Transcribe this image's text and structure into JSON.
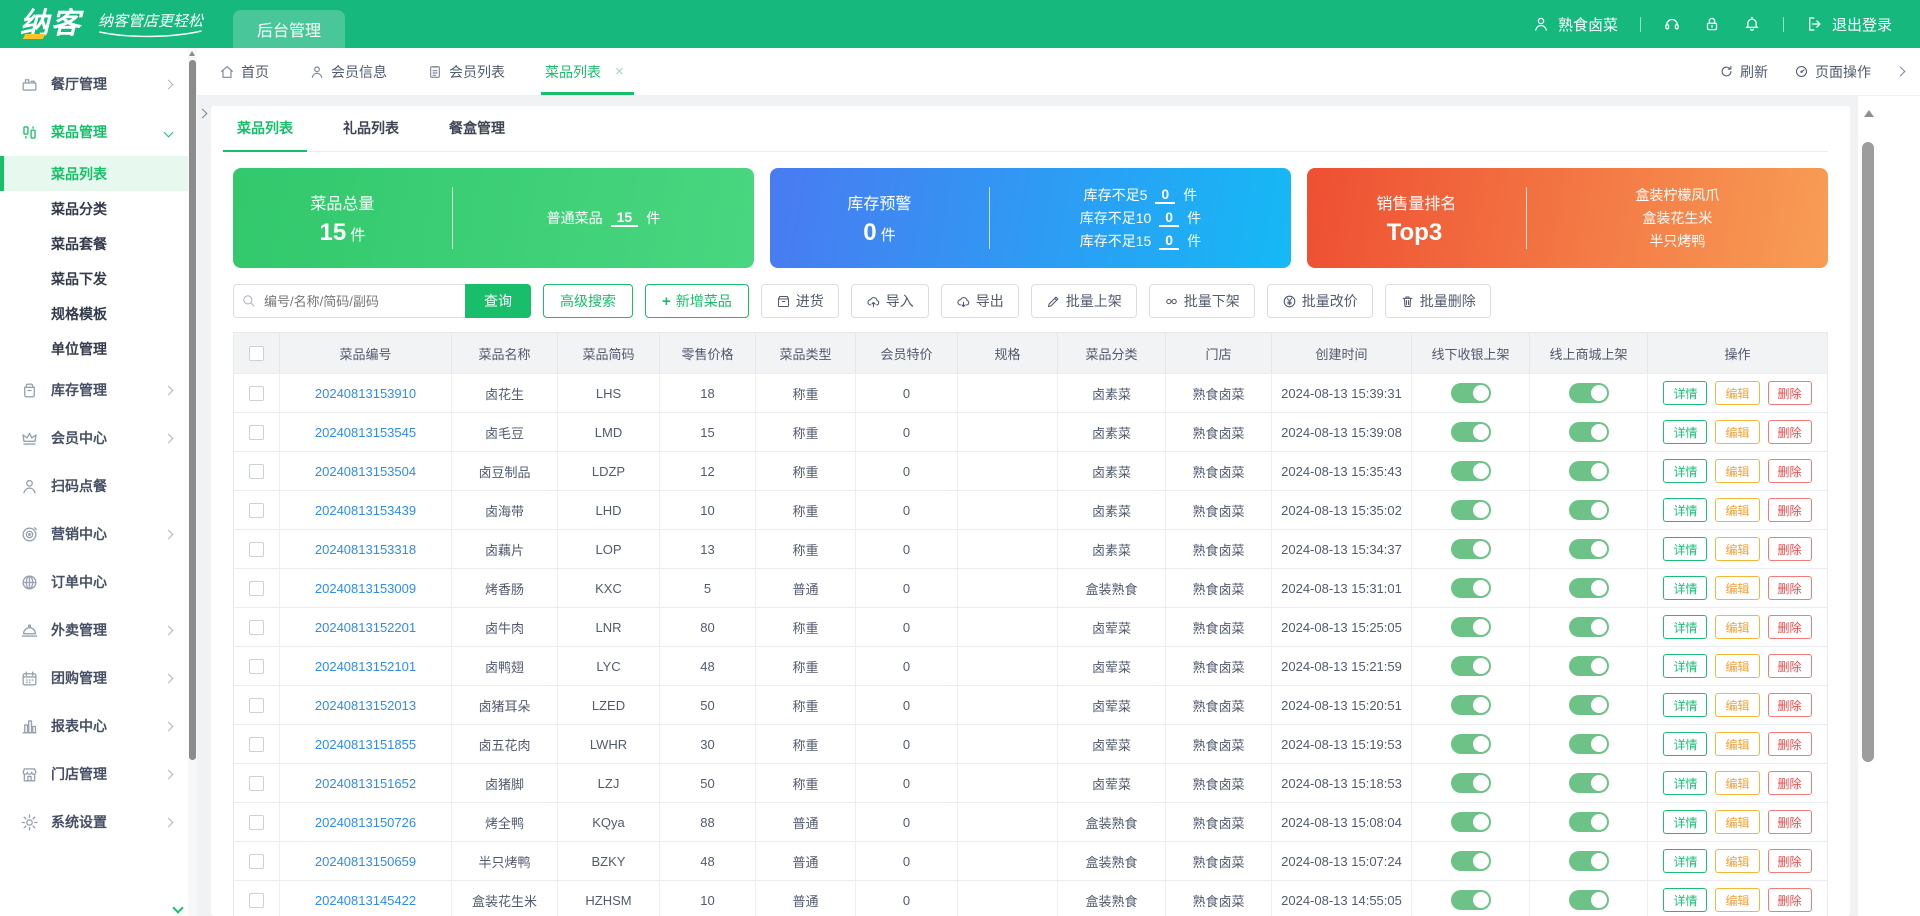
{
  "header": {
    "logo": "纳客",
    "tagline": "纳客管店更轻松",
    "admin_tab": "后台管理",
    "user": "熟食卤菜",
    "logout": "退出登录",
    "icons": [
      "user-icon",
      "headset-icon",
      "lock-icon",
      "bell-icon",
      "logout-icon"
    ]
  },
  "tabbar": {
    "tabs": [
      {
        "label": "首页",
        "icon": "home-icon"
      },
      {
        "label": "会员信息",
        "icon": "user-icon"
      },
      {
        "label": "会员列表",
        "icon": "document-icon"
      },
      {
        "label": "菜品列表",
        "active": true,
        "close": "×"
      }
    ],
    "refresh": "刷新",
    "page_ops": "页面操作"
  },
  "sidebar": {
    "items": [
      {
        "label": "餐厅管理",
        "icon": "store-icon",
        "arrow": "right"
      },
      {
        "label": "菜品管理",
        "icon": "dishes-icon",
        "arrow": "down",
        "open": true
      },
      {
        "label": "库存管理",
        "icon": "stock-icon",
        "arrow": "right"
      },
      {
        "label": "会员中心",
        "icon": "crown-icon",
        "arrow": "right"
      },
      {
        "label": "扫码点餐",
        "icon": "person-icon",
        "arrow": ""
      },
      {
        "label": "营销中心",
        "icon": "target-icon",
        "arrow": "right"
      },
      {
        "label": "订单中心",
        "icon": "globe-icon",
        "arrow": ""
      },
      {
        "label": "外卖管理",
        "icon": "cloche-icon",
        "arrow": "right"
      },
      {
        "label": "团购管理",
        "icon": "calendar-icon",
        "arrow": "right"
      },
      {
        "label": "报表中心",
        "icon": "chart-icon",
        "arrow": "right"
      },
      {
        "label": "门店管理",
        "icon": "shopfront-icon",
        "arrow": "right"
      },
      {
        "label": "系统设置",
        "icon": "gear-icon",
        "arrow": "right"
      }
    ],
    "dish_children": [
      {
        "label": "菜品列表",
        "active": true
      },
      {
        "label": "菜品分类"
      },
      {
        "label": "菜品套餐"
      },
      {
        "label": "菜品下发"
      },
      {
        "label": "规格模板"
      },
      {
        "label": "单位管理"
      }
    ]
  },
  "page": {
    "subtabs": [
      "菜品列表",
      "礼品列表",
      "餐盒管理"
    ],
    "cards": {
      "green": {
        "title": "菜品总量",
        "value": "15",
        "unit": "件",
        "rows": [
          {
            "label": "普通菜品",
            "value": "15",
            "unit": "件"
          }
        ]
      },
      "blue": {
        "title": "库存预警",
        "value": "0",
        "unit": "件",
        "rows": [
          {
            "label": "库存不足5",
            "value": "0",
            "unit": "件"
          },
          {
            "label": "库存不足10",
            "value": "0",
            "unit": "件"
          },
          {
            "label": "库存不足15",
            "value": "0",
            "unit": "件"
          }
        ]
      },
      "orange": {
        "title": "销售量排名",
        "value": "Top3",
        "items": [
          "盒装柠檬凤爪",
          "盒装花生米",
          "半只烤鸭"
        ]
      }
    },
    "toolbar": {
      "search_placeholder": "编号/名称/简码/副码",
      "query": "查询",
      "advanced": "高级搜索",
      "add_plus": "+",
      "add": "新增菜品",
      "gray_buttons": [
        {
          "label": "进货",
          "icon": "#i-box"
        },
        {
          "label": "导入",
          "icon": "#i-upload"
        },
        {
          "label": "导出",
          "icon": "#i-download"
        },
        {
          "label": "批量上架",
          "icon": "#i-pencil"
        },
        {
          "label": "批量下架",
          "icon": "#i-infinity"
        },
        {
          "label": "批量改价",
          "icon": "#i-yen"
        },
        {
          "label": "批量删除",
          "icon": "#i-trash"
        }
      ]
    },
    "table": {
      "columns": [
        "菜品编号",
        "菜品名称",
        "菜品简码",
        "零售价格",
        "菜品类型",
        "会员特价",
        "规格",
        "菜品分类",
        "门店",
        "创建时间",
        "线下收银上架",
        "线上商城上架",
        "操作"
      ],
      "actions": {
        "detail": "详情",
        "edit": "编辑",
        "del": "删除"
      },
      "rows": [
        {
          "code": "20240813153910",
          "name": "卤花生",
          "short": "LHS",
          "price": "18",
          "type": "称重",
          "vip": "0",
          "spec": "",
          "category": "卤素菜",
          "store": "熟食卤菜",
          "created": "2024-08-13 15:39:31"
        },
        {
          "code": "20240813153545",
          "name": "卤毛豆",
          "short": "LMD",
          "price": "15",
          "type": "称重",
          "vip": "0",
          "spec": "",
          "category": "卤素菜",
          "store": "熟食卤菜",
          "created": "2024-08-13 15:39:08"
        },
        {
          "code": "20240813153504",
          "name": "卤豆制品",
          "short": "LDZP",
          "price": "12",
          "type": "称重",
          "vip": "0",
          "spec": "",
          "category": "卤素菜",
          "store": "熟食卤菜",
          "created": "2024-08-13 15:35:43"
        },
        {
          "code": "20240813153439",
          "name": "卤海带",
          "short": "LHD",
          "price": "10",
          "type": "称重",
          "vip": "0",
          "spec": "",
          "category": "卤素菜",
          "store": "熟食卤菜",
          "created": "2024-08-13 15:35:02"
        },
        {
          "code": "20240813153318",
          "name": "卤藕片",
          "short": "LOP",
          "price": "13",
          "type": "称重",
          "vip": "0",
          "spec": "",
          "category": "卤素菜",
          "store": "熟食卤菜",
          "created": "2024-08-13 15:34:37"
        },
        {
          "code": "20240813153009",
          "name": "烤香肠",
          "short": "KXC",
          "price": "5",
          "type": "普通",
          "vip": "0",
          "spec": "",
          "category": "盒装熟食",
          "store": "熟食卤菜",
          "created": "2024-08-13 15:31:01"
        },
        {
          "code": "20240813152201",
          "name": "卤牛肉",
          "short": "LNR",
          "price": "80",
          "type": "称重",
          "vip": "0",
          "spec": "",
          "category": "卤荤菜",
          "store": "熟食卤菜",
          "created": "2024-08-13 15:25:05"
        },
        {
          "code": "20240813152101",
          "name": "卤鸭翅",
          "short": "LYC",
          "price": "48",
          "type": "称重",
          "vip": "0",
          "spec": "",
          "category": "卤荤菜",
          "store": "熟食卤菜",
          "created": "2024-08-13 15:21:59"
        },
        {
          "code": "20240813152013",
          "name": "卤猪耳朵",
          "short": "LZED",
          "price": "50",
          "type": "称重",
          "vip": "0",
          "spec": "",
          "category": "卤荤菜",
          "store": "熟食卤菜",
          "created": "2024-08-13 15:20:51"
        },
        {
          "code": "20240813151855",
          "name": "卤五花肉",
          "short": "LWHR",
          "price": "30",
          "type": "称重",
          "vip": "0",
          "spec": "",
          "category": "卤荤菜",
          "store": "熟食卤菜",
          "created": "2024-08-13 15:19:53"
        },
        {
          "code": "20240813151652",
          "name": "卤猪脚",
          "short": "LZJ",
          "price": "50",
          "type": "称重",
          "vip": "0",
          "spec": "",
          "category": "卤荤菜",
          "store": "熟食卤菜",
          "created": "2024-08-13 15:18:53"
        },
        {
          "code": "20240813150726",
          "name": "烤全鸭",
          "short": "KQya",
          "price": "88",
          "type": "普通",
          "vip": "0",
          "spec": "",
          "category": "盒装熟食",
          "store": "熟食卤菜",
          "created": "2024-08-13 15:08:04"
        },
        {
          "code": "20240813150659",
          "name": "半只烤鸭",
          "short": "BZKY",
          "price": "48",
          "type": "普通",
          "vip": "0",
          "spec": "",
          "category": "盒装熟食",
          "store": "熟食卤菜",
          "created": "2024-08-13 15:07:24"
        },
        {
          "code": "20240813145422",
          "name": "盒装花生米",
          "short": "HZHSM",
          "price": "10",
          "type": "普通",
          "vip": "0",
          "spec": "",
          "category": "盒装熟食",
          "store": "熟食卤菜",
          "created": "2024-08-13 14:55:05"
        }
      ]
    }
  },
  "colors": {
    "header_green": "#17b87e",
    "accent_green": "#19be6b",
    "link_blue": "#2d8cf0",
    "card_green": [
      "#32c86c",
      "#49d680"
    ],
    "card_blue": [
      "#4a7af1",
      "#15b9f5"
    ],
    "card_orange": [
      "#ee4f32",
      "#f89d55"
    ],
    "toggle_on": "#6dc387",
    "edit_yellow": "#f0a23a",
    "delete_red": "#ee4b4b"
  }
}
